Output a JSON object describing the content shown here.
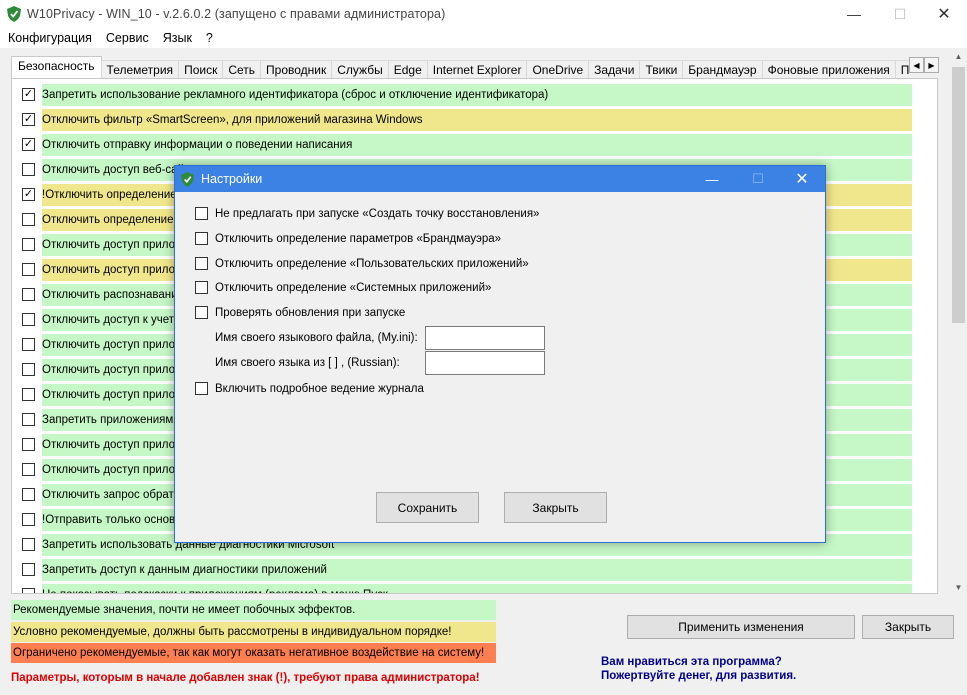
{
  "window": {
    "title": "W10Privacy - WIN_10 - v.2.6.0.2 (запущено с правами администратора)",
    "controls": {
      "minimize": "—",
      "maximize": "☐",
      "close": "✕"
    }
  },
  "menu": [
    "Конфигурация",
    "Сервис",
    "Язык",
    "?"
  ],
  "tabs": [
    "Безопасность",
    "Телеметрия",
    "Поиск",
    "Сеть",
    "Проводник",
    "Службы",
    "Edge",
    "Internet Explorer",
    "OneDrive",
    "Задачи",
    "Твики",
    "Брандмауэр",
    "Фоновые приложения",
    "Пользова"
  ],
  "active_tab": "Безопасность",
  "colors": {
    "green": "#c6f7c6",
    "yellow": "#f0e68c",
    "red": "#ff7f50",
    "dialog_title": "#3c82e4"
  },
  "rows": [
    {
      "label": "Запретить использование рекламного идентификатора (сброс и отключение идентификатора)",
      "checked": true,
      "color": "green"
    },
    {
      "label": "Отключить фильтр «SmartScreen», для приложений магазина Windows",
      "checked": true,
      "color": "yellow"
    },
    {
      "label": "Отключить отправку информации о поведении написания",
      "checked": true,
      "color": "green"
    },
    {
      "label": "Отключить доступ веб-сай",
      "checked": false,
      "color": "green"
    },
    {
      "label": "!Отключить определение м",
      "checked": true,
      "color": "yellow"
    },
    {
      "label": "Отключить определение м",
      "checked": false,
      "color": "yellow"
    },
    {
      "label": "Отключить доступ прилож",
      "checked": false,
      "color": "green"
    },
    {
      "label": "Отключить доступ прилож",
      "checked": false,
      "color": "yellow"
    },
    {
      "label": "Отключить распознавание",
      "checked": false,
      "color": "green"
    },
    {
      "label": "Отключить доступ к учетно",
      "checked": false,
      "color": "green"
    },
    {
      "label": "Отключить доступ прилож",
      "checked": false,
      "color": "green"
    },
    {
      "label": "Отключить доступ прилож",
      "checked": false,
      "color": "green"
    },
    {
      "label": "Отключить доступ прилож",
      "checked": false,
      "color": "green"
    },
    {
      "label": "Запретить приложениям ч",
      "checked": false,
      "color": "green"
    },
    {
      "label": "Отключить доступ прилож",
      "checked": false,
      "color": "green"
    },
    {
      "label": "Отключить доступ прилож",
      "checked": false,
      "color": "green"
    },
    {
      "label": "Отключить запрос обратн",
      "checked": false,
      "color": "green"
    },
    {
      "label": "!Отправить только основн",
      "checked": false,
      "color": "green"
    },
    {
      "label": "Запретить использовать данные диагностики Microsoft",
      "checked": false,
      "color": "green"
    },
    {
      "label": "Запретить доступ к данным диагностики приложений",
      "checked": false,
      "color": "green"
    },
    {
      "label": "Не показывать подсказки к приложениям (реклама) в меню Пуск",
      "checked": false,
      "color": "green"
    }
  ],
  "legend": {
    "green": "Рекомендуемые значения, почти не имеет побочных эффектов.",
    "yellow": "Условно рекомендуемые, должны быть рассмотрены в индивидуальном порядке!",
    "red": "Ограничено рекомендуемые, так как могут оказать негативное воздействие на систему!"
  },
  "admin_note": "Параметры, которым в начале добавлен знак (!), требуют права администратора!",
  "donate": {
    "line1": "Вам нравиться эта программа?",
    "line2": "Пожертвуйте денег, для развития."
  },
  "buttons": {
    "apply": "Применить изменения",
    "close": "Закрыть"
  },
  "dialog": {
    "title": "Настройки",
    "options": [
      "Не предлагать при запуске «Создать точку восстановления»",
      "Отключить определение параметров «Брандмауэра»",
      "Отключить определение «Пользовательских приложений»",
      "Отключить определение «Системных приложений»",
      "Проверять обновления при запуске"
    ],
    "lang_file_label": "Имя своего языкового файла, (My.ini):",
    "lang_file_value": "",
    "lang_name_label": "Имя своего языка из [ ] , (Russian):",
    "lang_name_value": "",
    "verbose_log": "Включить подробное ведение журнала",
    "save": "Сохранить",
    "close": "Закрыть"
  }
}
